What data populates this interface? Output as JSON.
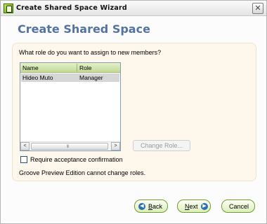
{
  "window": {
    "title": "Create Shared Space Wizard",
    "close_glyph": "✕"
  },
  "header": {
    "title": "Create Shared Space"
  },
  "panel": {
    "question": "What role do you want to assign to new members?",
    "members_table": {
      "columns": [
        "Name",
        "Role"
      ],
      "rows": [
        {
          "name": "Hideo Muto",
          "role": "Manager"
        }
      ]
    },
    "scrollbar": {
      "left_arrow": "<",
      "right_arrow": ">",
      "grip": "III"
    },
    "change_role_label": "Change Role...",
    "require_confirmation_label": "Require acceptance confirmation",
    "require_confirmation_checked": false,
    "note": "Groove Preview Edition cannot change roles."
  },
  "footer": {
    "back_label": "Back",
    "back_key": "B",
    "back_rest": "ack",
    "next_label": "Next",
    "next_key": "N",
    "next_rest": "ext",
    "cancel_label": "Cancel",
    "back_arrow": "◀",
    "next_arrow": "▶"
  },
  "colors": {
    "header_title": "#5373a0",
    "panel_bg": "#fdf7ec",
    "list_header": "#c3da96",
    "selected_row": "#d6d6d6",
    "button_border": "#6f9e2a"
  }
}
